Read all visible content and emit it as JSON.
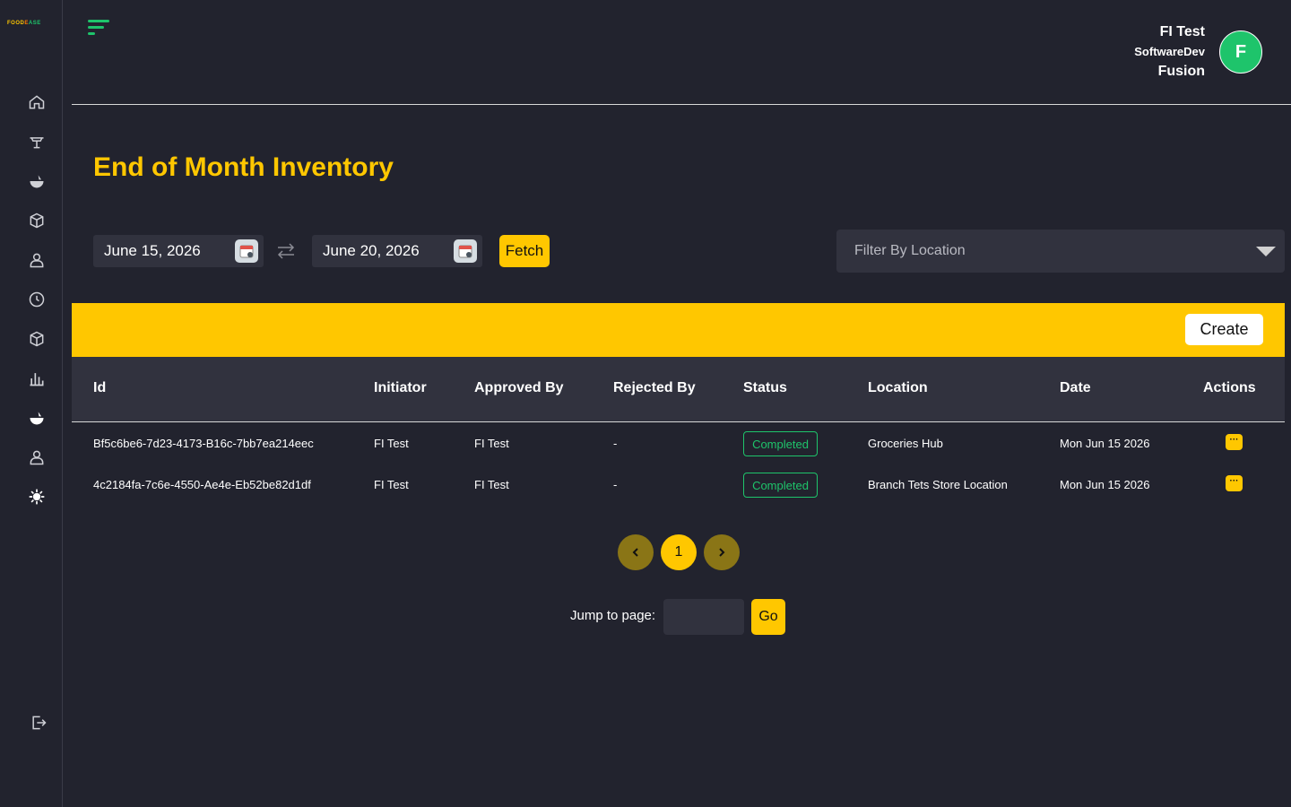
{
  "brand": {
    "logo_part1": "FOOD",
    "logo_part2": "E",
    "logo_part3": "ASE"
  },
  "sidebar": {
    "items": [
      {
        "icon": "home-icon"
      },
      {
        "icon": "dining-table-icon"
      },
      {
        "icon": "food-bowl-icon"
      },
      {
        "icon": "box-icon"
      },
      {
        "icon": "user-icon"
      },
      {
        "icon": "clock-icon"
      },
      {
        "icon": "package-icon"
      },
      {
        "icon": "bar-chart-icon"
      },
      {
        "icon": "fruit-icon"
      },
      {
        "icon": "user-icon"
      },
      {
        "icon": "gear-icon"
      }
    ],
    "logout_icon": "logout-icon"
  },
  "header": {
    "user_name": "FI Test",
    "user_company": "SoftwareDev",
    "user_org": "Fusion",
    "avatar_letter": "F"
  },
  "page": {
    "title": "End of Month Inventory"
  },
  "filters": {
    "start_date": "June 15, 2026",
    "end_date": "June 20, 2026",
    "fetch_label": "Fetch",
    "location_placeholder": "Filter By Location"
  },
  "toolbar": {
    "create_label": "Create"
  },
  "table": {
    "headers": [
      "Id",
      "Initiator",
      "Approved By",
      "Rejected By",
      "Status",
      "Location",
      "Date",
      "Actions"
    ],
    "rows": [
      {
        "id": "Bf5c6be6-7d23-4173-B16c-7bb7ea214eec",
        "initiator": "FI Test",
        "approved_by": "FI Test",
        "rejected_by": "-",
        "status": "Completed",
        "location": "Groceries Hub",
        "date": "Mon Jun 15 2026",
        "action": "···"
      },
      {
        "id": "4c2184fa-7c6e-4550-Ae4e-Eb52be82d1df",
        "initiator": "FI Test",
        "approved_by": "FI Test",
        "rejected_by": "-",
        "status": "Completed",
        "location": "Branch Tets Store Location",
        "date": "Mon Jun 15 2026",
        "action": "···"
      }
    ]
  },
  "pagination": {
    "current_page": "1",
    "jump_label": "Jump to page:",
    "go_label": "Go"
  },
  "colors": {
    "accent": "#ffc700",
    "brand_green": "#1ec46b",
    "background": "#22232e",
    "surface": "#31323e"
  }
}
